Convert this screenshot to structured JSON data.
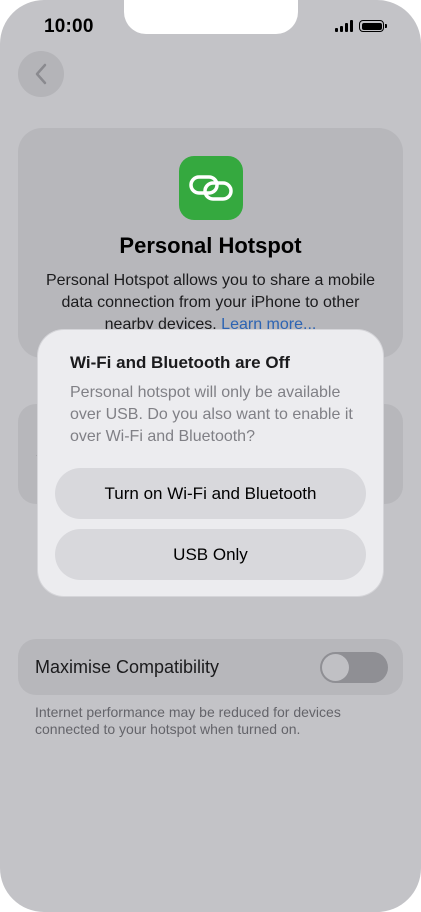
{
  "status_bar": {
    "time": "10:00",
    "signal_icon": "cellular-signal-icon",
    "battery_icon": "battery-full-icon"
  },
  "nav": {
    "back_icon": "chevron-left-icon"
  },
  "hotspot": {
    "app_icon": "link-icon",
    "title": "Personal Hotspot",
    "description": "Personal Hotspot allows you to share a mobile data connection from your iPhone to other nearby devices.",
    "learn_more": "Learn more..."
  },
  "compatibility": {
    "label": "Maximise Compatibility",
    "toggle_on": false,
    "note": "Internet performance may be reduced for devices connected to your hotspot when turned on."
  },
  "dialog": {
    "title": "Wi-Fi and Bluetooth are Off",
    "message": "Personal hotspot will only be available over USB. Do you also want to enable it over Wi-Fi and Bluetooth?",
    "primary_button": "Turn on Wi-Fi and Bluetooth",
    "secondary_button": "USB Only"
  },
  "colors": {
    "dimmed_background": "#c3c3c7",
    "app_icon_green": "#35a93f",
    "link_blue": "#2d64b3",
    "dialog_background": "#ececef"
  }
}
